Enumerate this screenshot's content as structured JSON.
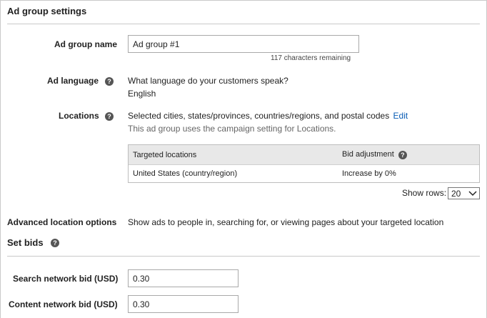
{
  "section": {
    "title": "Ad group settings"
  },
  "ad_group_name": {
    "label": "Ad group name",
    "value": "Ad group #1",
    "hint": "117 characters remaining"
  },
  "ad_language": {
    "label": "Ad language",
    "help_icon": "help-icon",
    "question": "What language do your customers speak?",
    "value": "English"
  },
  "locations": {
    "label": "Locations",
    "help_icon": "help-icon",
    "summary": "Selected cities, states/provinces, countries/regions, and postal codes",
    "edit_link": "Edit",
    "note": "This ad group uses the campaign setting for Locations.",
    "table": {
      "headers": [
        "Targeted locations",
        "Bid adjustment"
      ],
      "rows": [
        [
          "United States (country/region)",
          "Increase by 0%"
        ]
      ]
    },
    "show_rows_label": "Show  rows:",
    "rows_value": "20"
  },
  "advanced_location": {
    "label": "Advanced location options",
    "value": "Show ads to people in, searching for, or viewing pages about your targeted location"
  },
  "set_bids": {
    "title": "Set bids",
    "search_label": "Search network bid (USD)",
    "search_value": "0.30",
    "content_label": "Content network bid (USD)",
    "content_value": "0.30"
  },
  "colors": {
    "link": "#0a5db5",
    "table_header": "#e8e8e8",
    "divider": "#c9c9c9"
  }
}
